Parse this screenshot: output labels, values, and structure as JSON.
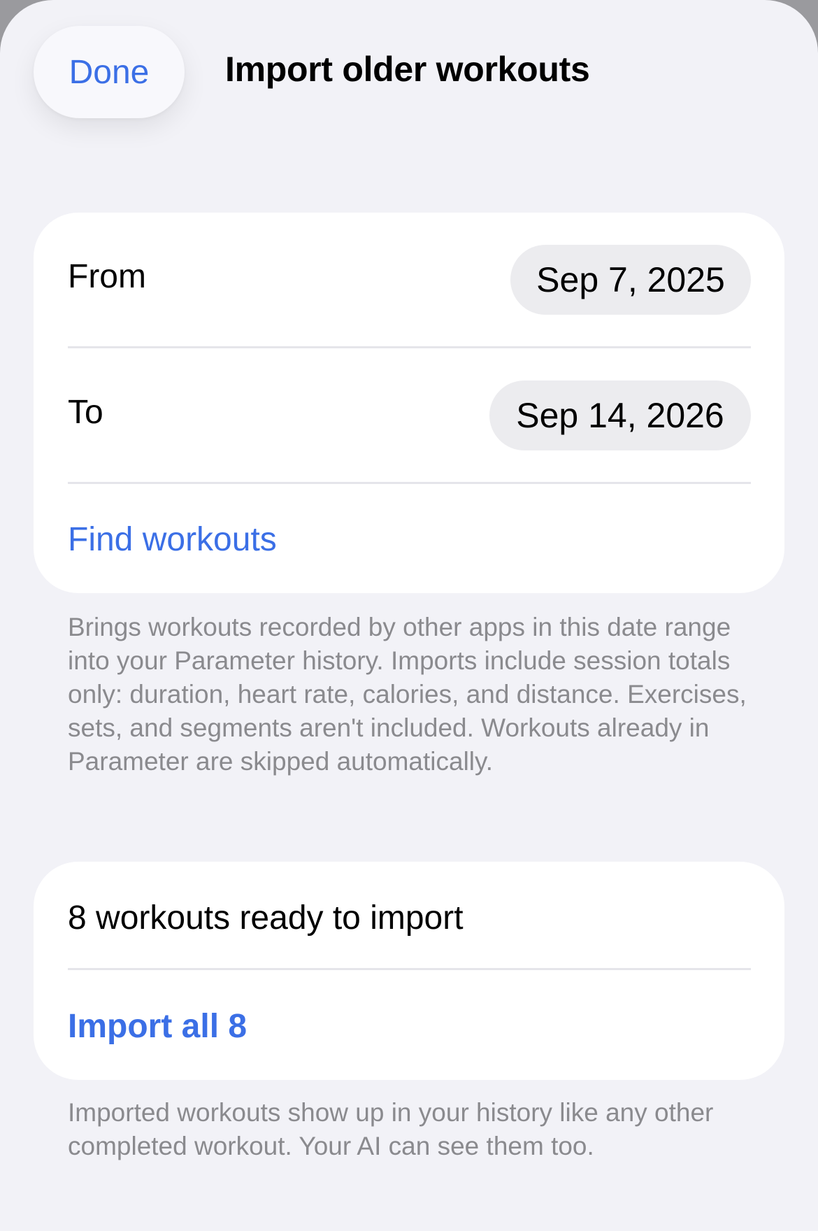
{
  "header": {
    "done_label": "Done",
    "title": "Import older workouts"
  },
  "date_range": {
    "from_label": "From",
    "from_value": "Sep 7, 2025",
    "to_label": "To",
    "to_value": "Sep 14, 2026",
    "find_label": "Find workouts"
  },
  "range_footnote": "Brings workouts recorded by other apps in this date range into your Parameter history. Imports include session totals only: duration, heart rate, calories, and distance. Exercises, sets, and segments aren't included. Workouts already in Parameter are skipped automatically.",
  "import_section": {
    "status": "8 workouts ready to import",
    "import_label": "Import all 8"
  },
  "import_footnote": "Imported workouts show up in your history like any other completed workout. Your AI can see them too.",
  "colors": {
    "accent": "#3b6fe6",
    "background": "#f2f2f7",
    "card": "#ffffff",
    "secondary_text": "#8a8a8e"
  }
}
